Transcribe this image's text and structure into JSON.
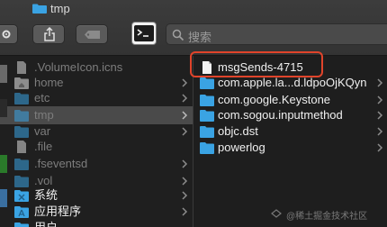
{
  "window": {
    "title": "tmp"
  },
  "toolbar": {
    "search_placeholder": "搜索"
  },
  "column1": {
    "items": [
      {
        "label": ".VolumeIcon.icns",
        "icon": "document-icon",
        "hidden": true,
        "has_children": false
      },
      {
        "label": "home",
        "icon": "folder-icon",
        "hidden": false,
        "has_children": true
      },
      {
        "label": "etc",
        "icon": "folder-icon",
        "hidden": true,
        "has_children": true
      },
      {
        "label": "tmp",
        "icon": "folder-icon",
        "hidden": true,
        "has_children": true,
        "selected": true
      },
      {
        "label": "var",
        "icon": "folder-icon",
        "hidden": true,
        "has_children": true
      },
      {
        "label": ".file",
        "icon": "document-icon",
        "hidden": true,
        "has_children": false
      },
      {
        "label": ".fseventsd",
        "icon": "folder-icon",
        "hidden": true,
        "has_children": true
      },
      {
        "label": ".vol",
        "icon": "folder-icon",
        "hidden": true,
        "has_children": true
      },
      {
        "label": "系统",
        "icon": "system-folder-icon",
        "hidden": false,
        "has_children": true
      },
      {
        "label": "应用程序",
        "icon": "applications-folder-icon",
        "hidden": false,
        "has_children": true
      },
      {
        "label": "用户",
        "icon": "users-folder-icon",
        "hidden": false,
        "has_children": true
      }
    ]
  },
  "column2": {
    "items": [
      {
        "label": "msgSends-4715",
        "icon": "document-icon",
        "has_children": false,
        "highlighted": true
      },
      {
        "label": "com.apple.la...d.ldpoOjKQyn",
        "icon": "folder-icon",
        "has_children": true
      },
      {
        "label": "com.google.Keystone",
        "icon": "folder-icon",
        "has_children": true
      },
      {
        "label": "com.sogou.inputmethod",
        "icon": "folder-icon",
        "has_children": true
      },
      {
        "label": "objc.dst",
        "icon": "folder-icon",
        "has_children": true
      },
      {
        "label": "powerlog",
        "icon": "folder-icon",
        "has_children": true
      }
    ]
  },
  "watermark": {
    "text": "@稀土掘金技术社区"
  },
  "colors": {
    "folder": "#3aa3e3",
    "highlight": "#e0442b",
    "selected_row": "#4a4a4a"
  }
}
